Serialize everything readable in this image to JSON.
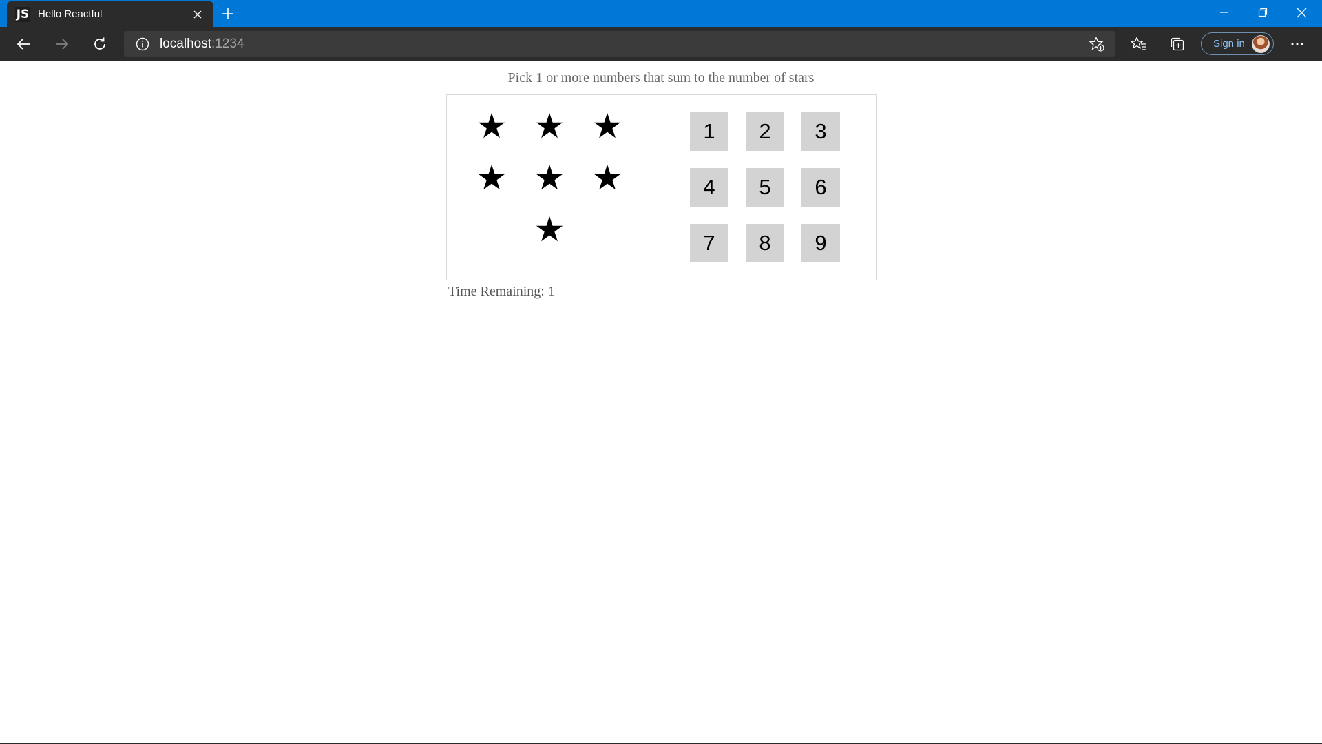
{
  "browser": {
    "tab": {
      "favicon_text": "JS",
      "title": "Hello Reactful"
    },
    "address": {
      "host": "localhost",
      "port": ":1234"
    },
    "signin_label": "Sign in",
    "accent_color": "#0078d7",
    "icons": [
      "close-icon",
      "plus-icon",
      "minimize-icon",
      "restore-icon",
      "back-arrow-icon",
      "forward-arrow-icon",
      "refresh-icon",
      "info-icon",
      "add-favorite-icon",
      "favorites-icon",
      "collections-icon",
      "more-icon"
    ]
  },
  "game": {
    "help_text": "Pick 1 or more numbers that sum to the number of stars",
    "star_count": 7,
    "star_glyph": "★",
    "numbers": [
      "1",
      "2",
      "3",
      "4",
      "5",
      "6",
      "7",
      "8",
      "9"
    ],
    "timer": {
      "label": "Time Remaining: 1"
    },
    "number_button_color": "#d3d3d3"
  }
}
